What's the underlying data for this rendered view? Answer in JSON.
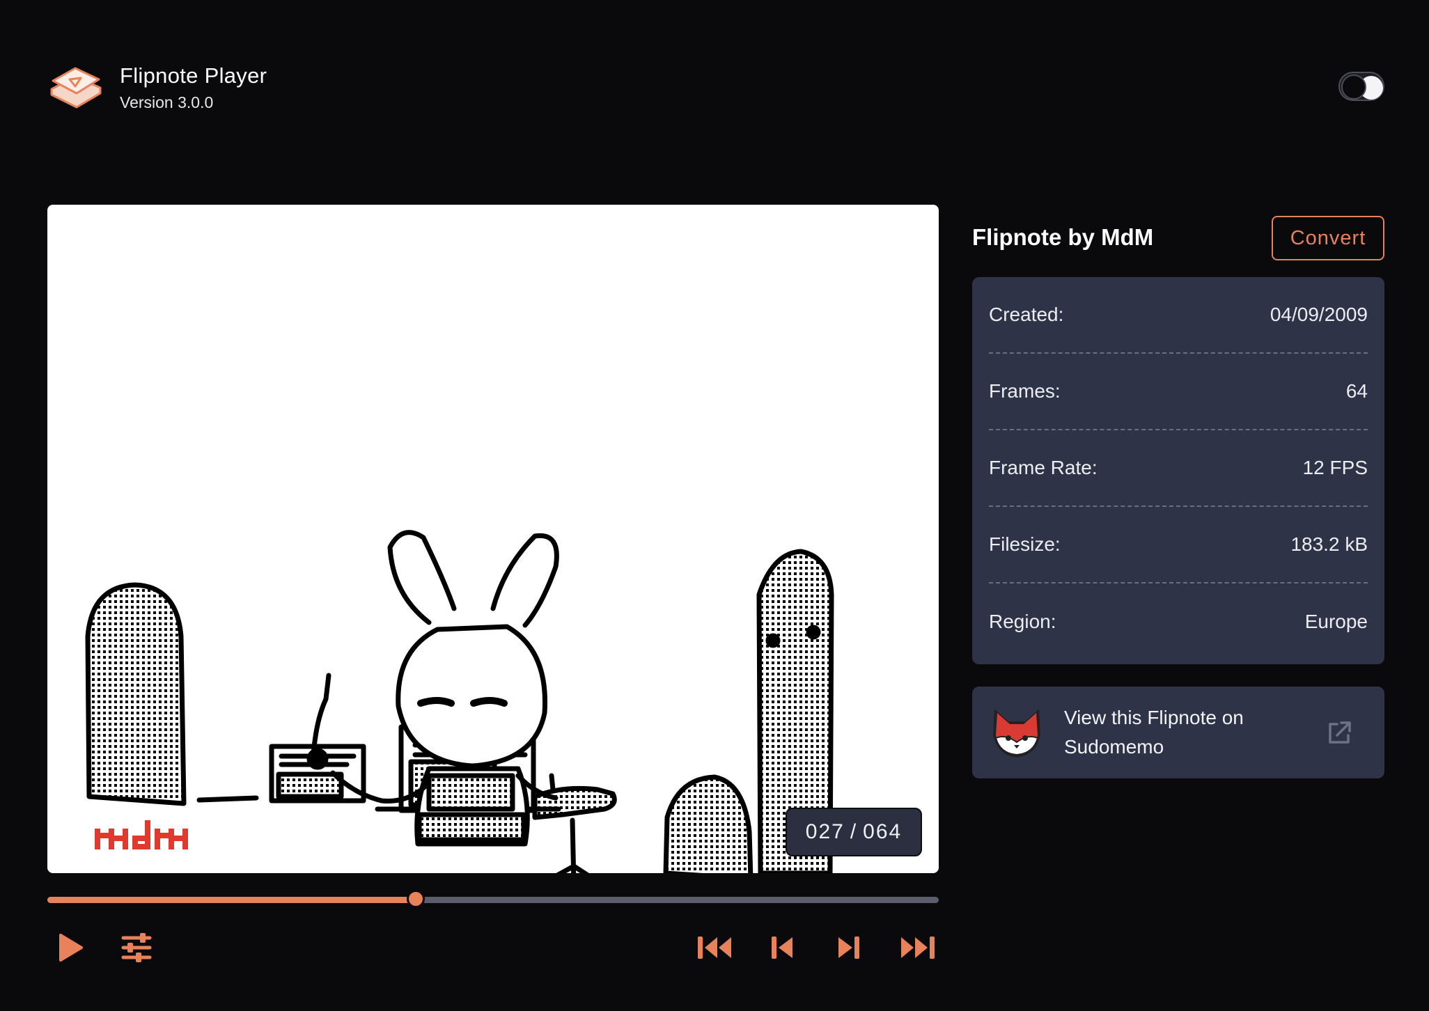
{
  "app": {
    "title": "Flipnote Player",
    "version": "Version 3.0.0"
  },
  "theme_toggle": {
    "state": "dark"
  },
  "player": {
    "current_frame": "027",
    "total_frames": "064",
    "progress_fraction": 0.413,
    "signature": "MdM"
  },
  "controls": {
    "play": "play-icon",
    "settings": "sliders-icon",
    "first_frame": "skip-first-icon",
    "prev_frame": "step-back-icon",
    "next_frame": "step-forward-icon",
    "last_frame": "skip-last-icon"
  },
  "sidebar": {
    "title": "Flipnote by MdM",
    "convert_label": "Convert",
    "meta": [
      {
        "label": "Created:",
        "value": "04/09/2009"
      },
      {
        "label": "Frames:",
        "value": "64"
      },
      {
        "label": "Frame Rate:",
        "value": "12 FPS"
      },
      {
        "label": "Filesize:",
        "value": "183.2 kB"
      },
      {
        "label": "Region:",
        "value": "Europe"
      }
    ],
    "sudomemo_link": "View this Flipnote on Sudomemo"
  },
  "colors": {
    "background": "#0a0a0d",
    "accent": "#e8825a",
    "card": "#2f3347",
    "track": "#5b5e6d"
  }
}
